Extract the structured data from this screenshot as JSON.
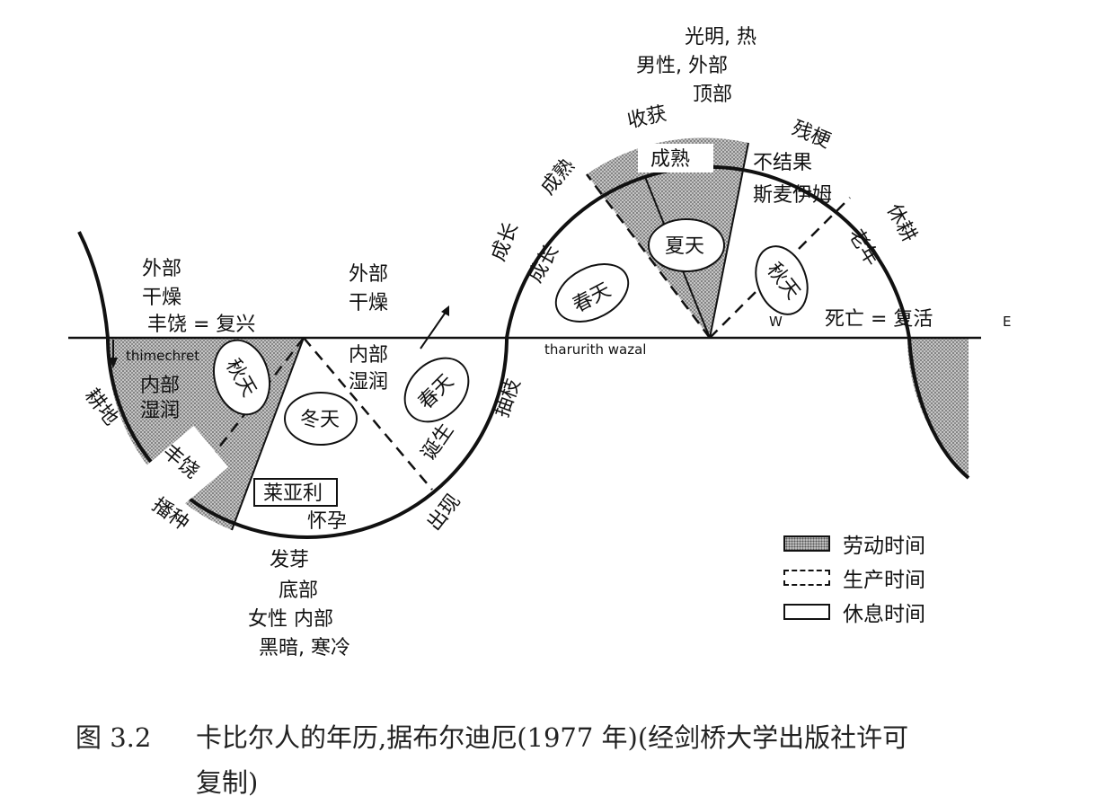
{
  "diagram": {
    "axis": {
      "west": "W",
      "east": "E",
      "center_label": "tharurith wazal"
    },
    "summer_side": {
      "top_notes": [
        "光明, 热",
        "男性,  外部",
        "顶部"
      ],
      "outer_labels": [
        "收获",
        "残梗",
        "休耕",
        "成熟",
        "成长"
      ],
      "inner_labels": [
        "成熟",
        "不结果",
        "斯麦伊姆",
        "成长",
        "老年"
      ],
      "seasons": [
        "夏天",
        "春天",
        "秋天"
      ],
      "death": "死亡 = 复活"
    },
    "winter_side": {
      "bottom_notes": [
        "发芽",
        "底部",
        "女性  内部",
        "黑暗, 寒冷"
      ],
      "left_notes": [
        "外部",
        "干燥",
        "丰饶 = 复兴"
      ],
      "mid_notes": [
        "外部",
        "干燥"
      ],
      "inner_labels": [
        "内部",
        "湿润",
        "内部",
        "湿润",
        "丰饶",
        "怀孕",
        "诞生"
      ],
      "thimechret": "thimechret",
      "layali": "莱亚利",
      "outer_labels": [
        "耕地",
        "播种",
        "出现",
        "抽枝"
      ],
      "seasons": [
        "秋天",
        "冬天",
        "春天"
      ]
    },
    "colors": {
      "labor_fill": "#b9b9b9",
      "line": "#111111"
    }
  },
  "legend": {
    "labor": "劳动时间",
    "production": "生产时间",
    "rest": "休息时间"
  },
  "caption": {
    "number": "图 3.2",
    "line1": "卡比尔人的年历,据布尔迪厄(1977 年)(经剑桥大学出版社许可",
    "line2": "复制)"
  }
}
